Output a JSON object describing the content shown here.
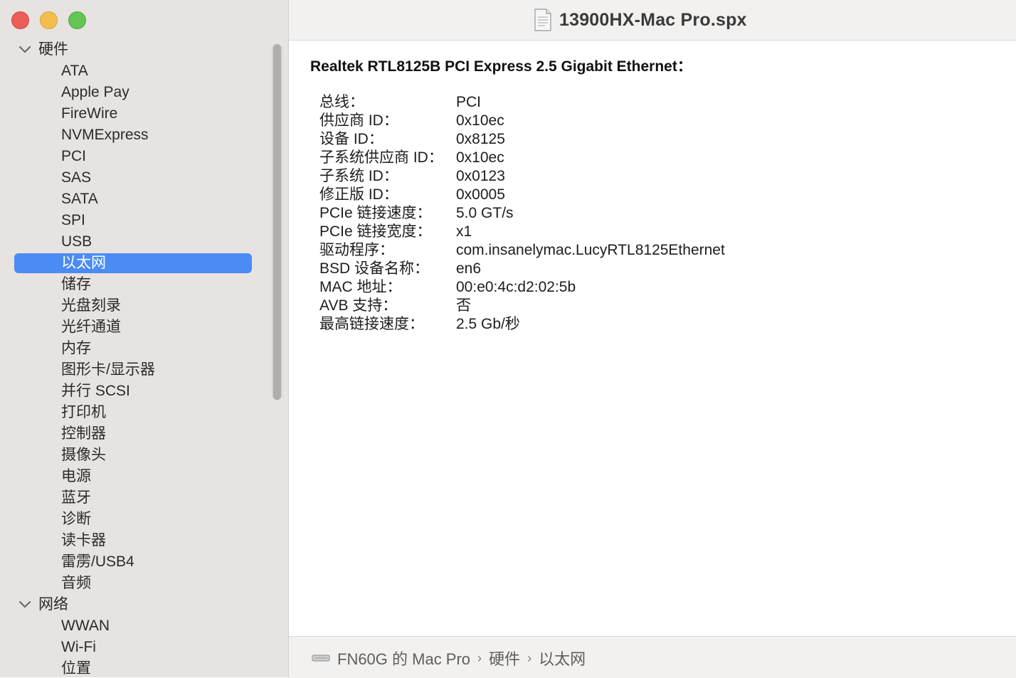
{
  "window": {
    "title": "13900HX-Mac Pro.spx"
  },
  "sidebar": {
    "sections": [
      {
        "label": "硬件",
        "items": [
          "ATA",
          "Apple Pay",
          "FireWire",
          "NVMExpress",
          "PCI",
          "SAS",
          "SATA",
          "SPI",
          "USB",
          "以太网",
          "储存",
          "光盘刻录",
          "光纤通道",
          "内存",
          "图形卡/显示器",
          "并行 SCSI",
          "打印机",
          "控制器",
          "摄像头",
          "电源",
          "蓝牙",
          "诊断",
          "读卡器",
          "雷雳/USB4",
          "音频"
        ]
      },
      {
        "label": "网络",
        "items": [
          "WWAN",
          "Wi-Fi",
          "位置"
        ]
      }
    ],
    "selected": "以太网"
  },
  "detail": {
    "heading": "Realtek RTL8125B PCI Express 2.5 Gigabit Ethernet：",
    "properties": [
      {
        "key": "总线：",
        "value": "PCI"
      },
      {
        "key": "供应商 ID：",
        "value": "0x10ec"
      },
      {
        "key": "设备 ID：",
        "value": "0x8125"
      },
      {
        "key": "子系统供应商 ID：",
        "value": "0x10ec"
      },
      {
        "key": "子系统 ID：",
        "value": "0x0123"
      },
      {
        "key": "修正版 ID：",
        "value": "0x0005"
      },
      {
        "key": "PCIe 链接速度：",
        "value": "5.0 GT/s"
      },
      {
        "key": "PCIe 链接宽度：",
        "value": "x1"
      },
      {
        "key": "驱动程序：",
        "value": "com.insanelymac.LucyRTL8125Ethernet"
      },
      {
        "key": "BSD 设备名称：",
        "value": "en6"
      },
      {
        "key": "MAC 地址：",
        "value": "00:e0:4c:d2:02:5b"
      },
      {
        "key": "AVB 支持：",
        "value": "否"
      },
      {
        "key": "最高链接速度：",
        "value": "2.5 Gb/秒"
      }
    ]
  },
  "pathbar": {
    "crumbs": [
      "FN60G 的 Mac Pro",
      "硬件",
      "以太网"
    ],
    "separator": "›"
  },
  "colors": {
    "selection": "#4b8cf4",
    "sidebar_bg": "#e6e3e1",
    "close": "#ec5f57",
    "minimize": "#f4be4f",
    "zoom": "#62c554"
  }
}
